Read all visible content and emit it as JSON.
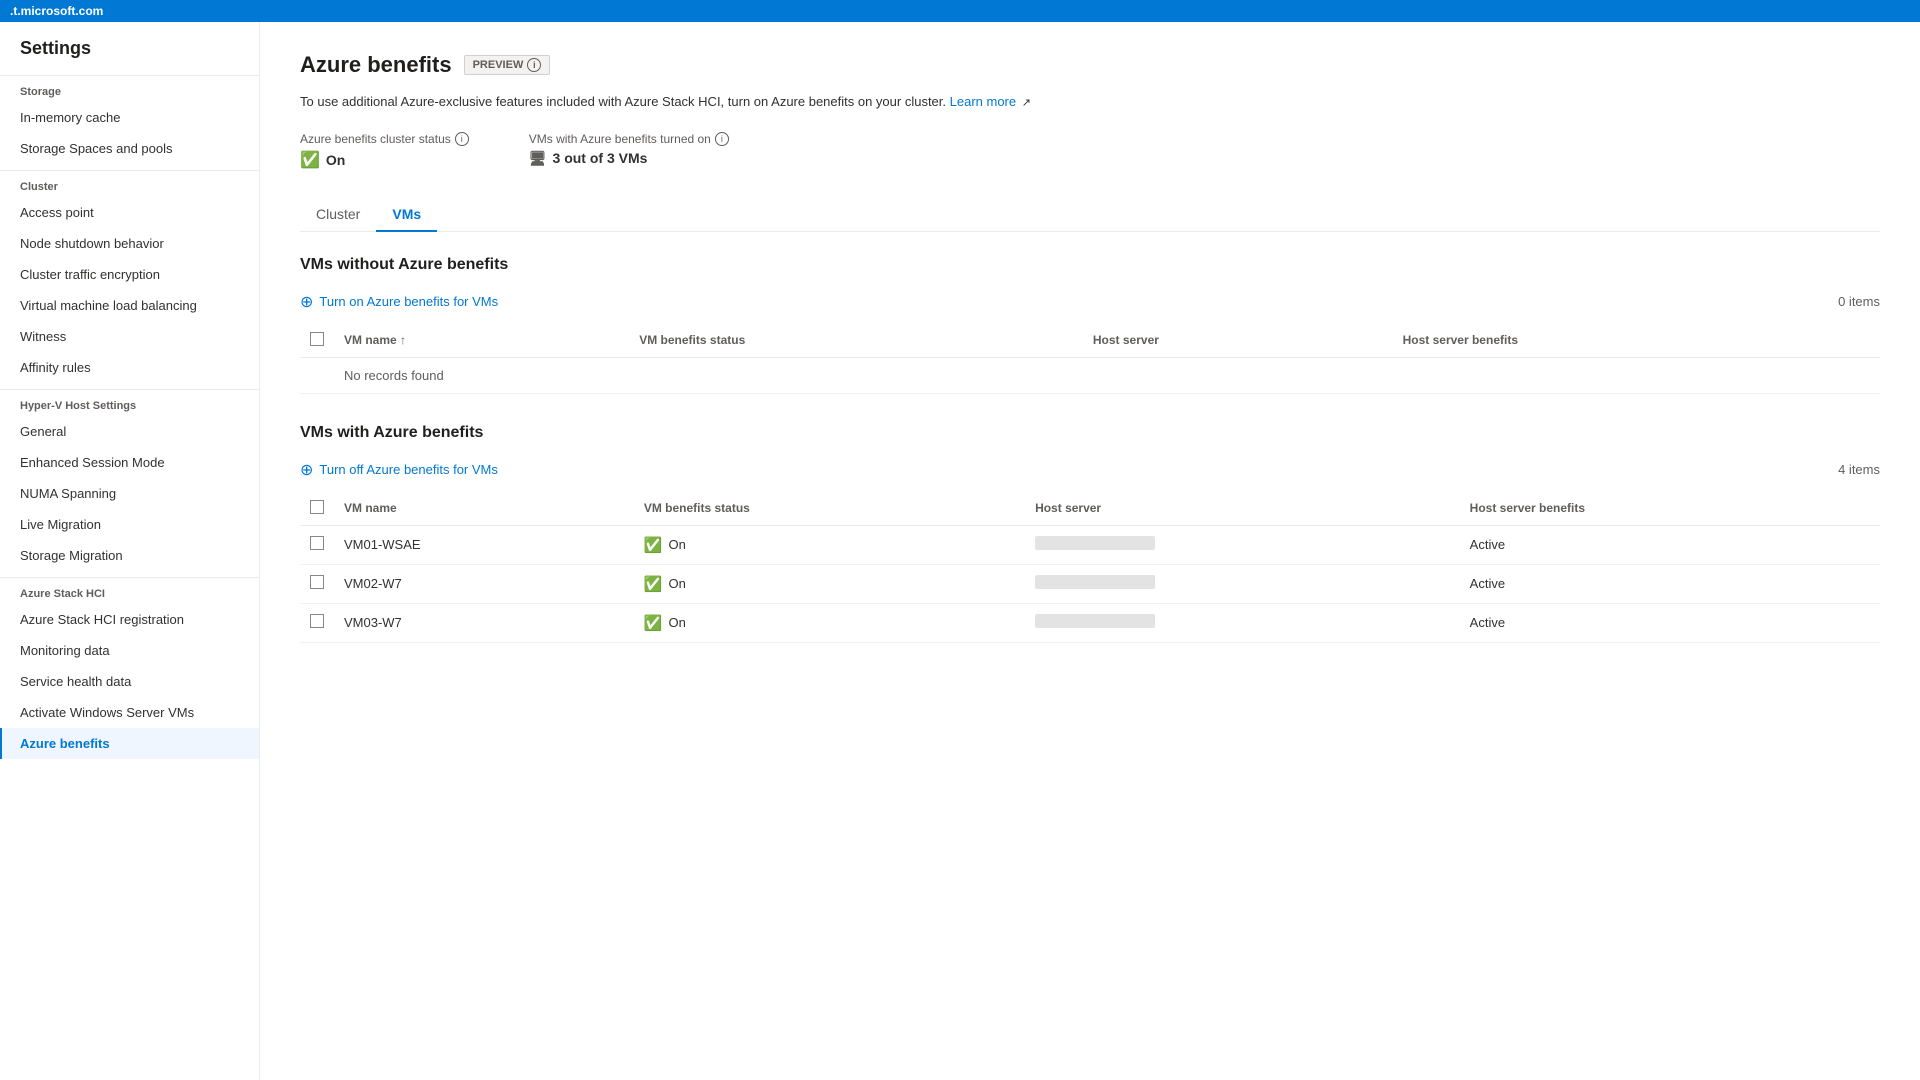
{
  "domain": {
    "url": ".t.microsoft.com"
  },
  "sidebar": {
    "title": "Settings",
    "sections": [
      {
        "label": "Storage",
        "items": [
          {
            "id": "in-memory-cache",
            "label": "In-memory cache",
            "active": false
          },
          {
            "id": "storage-spaces",
            "label": "Storage Spaces and pools",
            "active": false
          }
        ]
      },
      {
        "label": "Cluster",
        "items": [
          {
            "id": "access-point",
            "label": "Access point",
            "active": false
          },
          {
            "id": "node-shutdown",
            "label": "Node shutdown behavior",
            "active": false
          },
          {
            "id": "cluster-traffic",
            "label": "Cluster traffic encryption",
            "active": false
          },
          {
            "id": "vm-load-balancing",
            "label": "Virtual machine load balancing",
            "active": false
          },
          {
            "id": "witness",
            "label": "Witness",
            "active": false
          },
          {
            "id": "affinity-rules",
            "label": "Affinity rules",
            "active": false
          }
        ]
      },
      {
        "label": "Hyper-V Host Settings",
        "items": [
          {
            "id": "general",
            "label": "General",
            "active": false
          },
          {
            "id": "enhanced-session",
            "label": "Enhanced Session Mode",
            "active": false
          },
          {
            "id": "numa-spanning",
            "label": "NUMA Spanning",
            "active": false
          },
          {
            "id": "live-migration",
            "label": "Live Migration",
            "active": false
          },
          {
            "id": "storage-migration",
            "label": "Storage Migration",
            "active": false
          }
        ]
      },
      {
        "label": "Azure Stack HCI",
        "items": [
          {
            "id": "azure-stack-reg",
            "label": "Azure Stack HCI registration",
            "active": false
          },
          {
            "id": "monitoring-data",
            "label": "Monitoring data",
            "active": false
          },
          {
            "id": "service-health",
            "label": "Service health data",
            "active": false
          },
          {
            "id": "activate-windows",
            "label": "Activate Windows Server VMs",
            "active": false
          },
          {
            "id": "azure-benefits",
            "label": "Azure benefits",
            "active": true
          }
        ]
      }
    ]
  },
  "page": {
    "title": "Azure benefits",
    "preview_label": "PREVIEW",
    "description": "To use additional Azure-exclusive features included with Azure Stack HCI, turn on Azure benefits on your cluster.",
    "learn_more_label": "Learn more",
    "cluster_status_label": "Azure benefits cluster status",
    "cluster_status_value": "On",
    "vms_status_label": "VMs with Azure benefits turned on",
    "vms_status_value": "3 out of 3 VMs"
  },
  "tabs": [
    {
      "id": "cluster",
      "label": "Cluster",
      "active": false
    },
    {
      "id": "vms",
      "label": "VMs",
      "active": true
    }
  ],
  "vms_without": {
    "title": "VMs without Azure benefits",
    "action_label": "Turn on Azure benefits for VMs",
    "items_count": "0 items",
    "columns": [
      "VM name",
      "VM benefits status",
      "Host server",
      "Host server benefits"
    ],
    "no_records": "No records found"
  },
  "vms_with": {
    "title": "VMs with Azure benefits",
    "action_label": "Turn off Azure benefits for VMs",
    "items_count": "4 items",
    "columns": [
      "VM name",
      "VM benefits status",
      "Host server",
      "Host server benefits"
    ],
    "rows": [
      {
        "name": "VM01-WSAE",
        "status": "On",
        "host_server": "redacted",
        "host_benefits": "Active"
      },
      {
        "name": "VM02-W7",
        "status": "On",
        "host_server": "redacted",
        "host_benefits": "Active"
      },
      {
        "name": "VM03-W7",
        "status": "On",
        "host_server": "redacted",
        "host_benefits": "Active"
      }
    ]
  }
}
